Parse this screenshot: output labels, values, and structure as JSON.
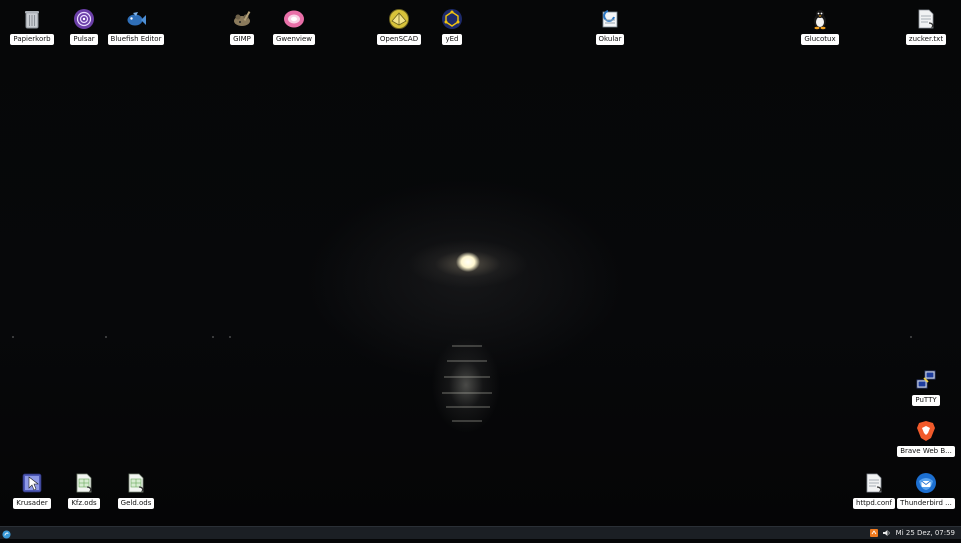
{
  "desktop": {
    "icons": [
      {
        "label": "Papierkorb",
        "icon": "trash-icon"
      },
      {
        "label": "Pulsar",
        "icon": "pulsar-icon"
      },
      {
        "label": "Bluefish Editor",
        "icon": "bluefish-icon"
      },
      {
        "label": "GIMP",
        "icon": "gimp-icon"
      },
      {
        "label": "Gwenview",
        "icon": "gwenview-icon"
      },
      {
        "label": "OpenSCAD",
        "icon": "openscad-icon"
      },
      {
        "label": "yEd",
        "icon": "yed-icon"
      },
      {
        "label": "Okular",
        "icon": "okular-icon"
      },
      {
        "label": "Glucotux",
        "icon": "tux-icon"
      },
      {
        "label": "zucker.txt",
        "icon": "text-file-link-icon"
      },
      {
        "label": "PuTTY",
        "icon": "putty-icon"
      },
      {
        "label": "Brave Web B...",
        "icon": "brave-icon"
      },
      {
        "label": "Krusader",
        "icon": "krusader-icon"
      },
      {
        "label": "Kfz.ods",
        "icon": "spreadsheet-link-icon"
      },
      {
        "label": "Geld.ods",
        "icon": "spreadsheet-link-icon"
      },
      {
        "label": "httpd.conf",
        "icon": "text-file-link-icon"
      },
      {
        "label": "Thunderbird ...",
        "icon": "thunderbird-icon"
      }
    ]
  },
  "taskbar": {
    "clock": "Mi 25 Dez, 07:59",
    "tray_icons": [
      "update-notifier-icon",
      "volume-icon"
    ],
    "start_icon": "start-menu-icon"
  },
  "colors": {
    "taskbar_bg": "#1b1f24",
    "label_bg": "#ffffff",
    "desktop_bg": "#050607"
  }
}
